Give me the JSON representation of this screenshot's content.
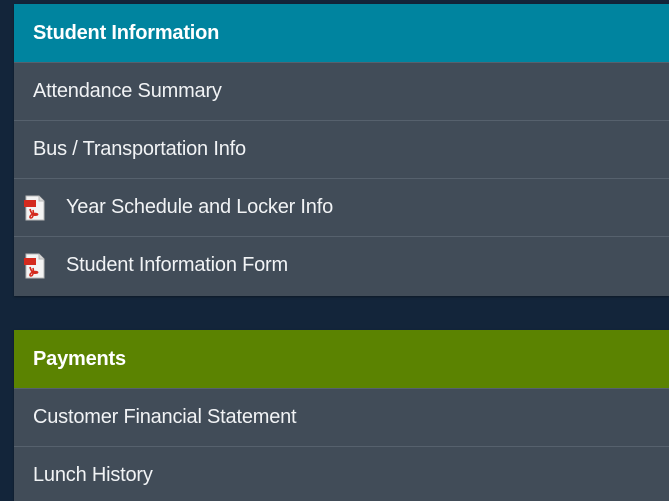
{
  "sections": [
    {
      "title": "Student Information",
      "header_color": "#00849f",
      "items": [
        {
          "label": "Attendance Summary",
          "icon": null
        },
        {
          "label": "Bus / Transportation Info",
          "icon": null
        },
        {
          "label": "Year Schedule and Locker Info",
          "icon": "pdf-icon"
        },
        {
          "label": "Student Information Form",
          "icon": "pdf-icon"
        }
      ]
    },
    {
      "title": "Payments",
      "header_color": "#5b8301",
      "items": [
        {
          "label": "Customer Financial Statement",
          "icon": null
        },
        {
          "label": "Lunch History",
          "icon": null
        }
      ]
    }
  ],
  "colors": {
    "background": "#13253a",
    "panel": "#414c58",
    "pdf_icon": "#d42a1e"
  }
}
